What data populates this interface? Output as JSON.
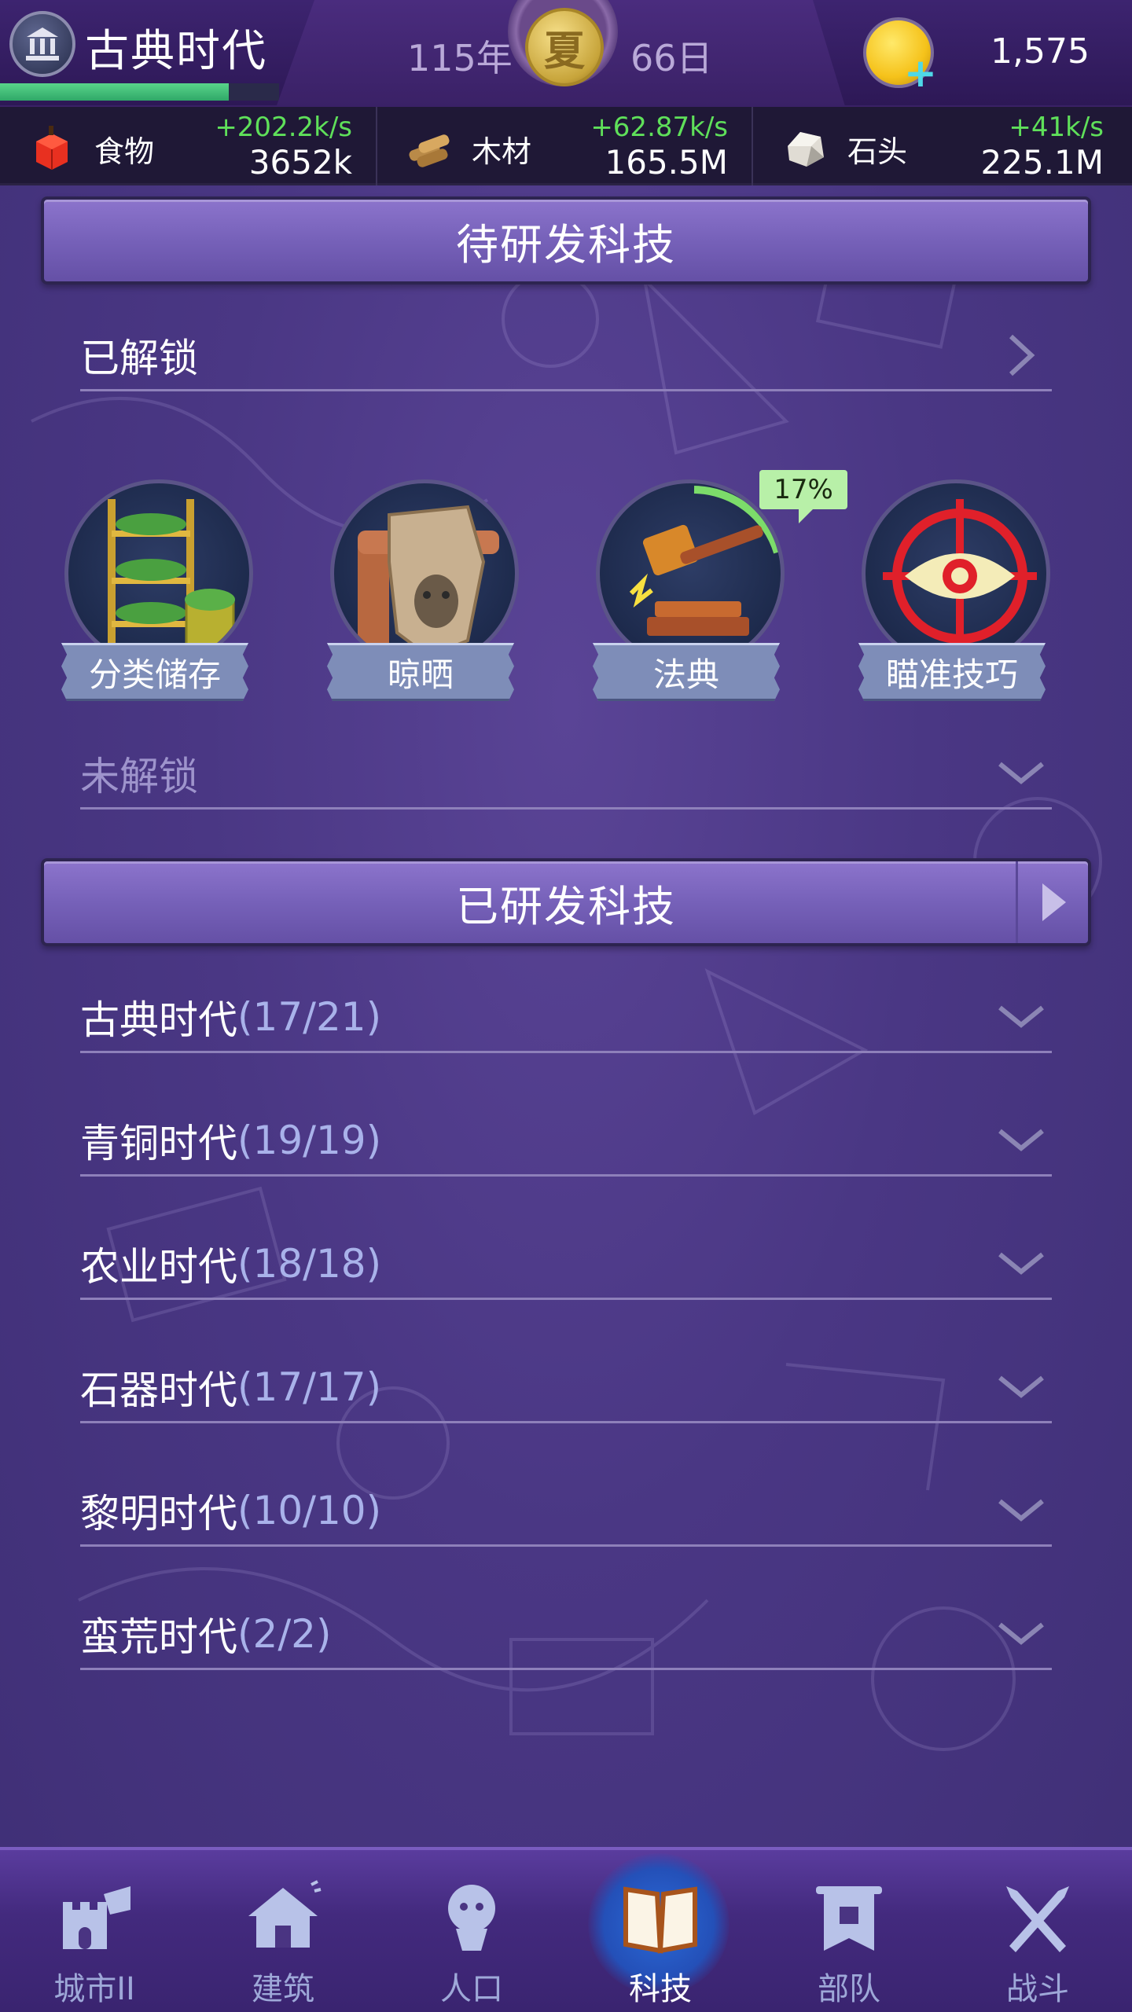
{
  "header": {
    "era_title": "古典时代",
    "era_progress": 0.82,
    "year": "115年",
    "season": "夏",
    "day": "66日",
    "gold": "1,575"
  },
  "resources": [
    {
      "name": "食物",
      "rate": "+202.2k/s",
      "total": "3652k",
      "icon": "food-icon"
    },
    {
      "name": "木材",
      "rate": "+62.87k/s",
      "total": "165.5M",
      "icon": "wood-icon"
    },
    {
      "name": "石头",
      "rate": "+41k/s",
      "total": "225.1M",
      "icon": "stone-icon"
    }
  ],
  "pending": {
    "title": "待研发科技",
    "unlocked_label": "已解锁",
    "locked_label": "未解锁",
    "techs": [
      {
        "name": "分类储存",
        "icon": "shelf-storage-icon"
      },
      {
        "name": "晾晒",
        "icon": "drying-hide-icon"
      },
      {
        "name": "法典",
        "icon": "gavel-icon",
        "progress": "17%"
      },
      {
        "name": "瞄准技巧",
        "icon": "target-eye-icon"
      }
    ]
  },
  "researched": {
    "title": "已研发科技",
    "eras": [
      {
        "name": "古典时代",
        "count": "(17/21)"
      },
      {
        "name": "青铜时代",
        "count": "(19/19)"
      },
      {
        "name": "农业时代",
        "count": "(18/18)"
      },
      {
        "name": "石器时代",
        "count": "(17/17)"
      },
      {
        "name": "黎明时代",
        "count": "(10/10)"
      },
      {
        "name": "蛮荒时代",
        "count": "(2/2)"
      }
    ]
  },
  "nav": [
    {
      "label": "城市II",
      "icon": "castle-icon"
    },
    {
      "label": "建筑",
      "icon": "house-icon"
    },
    {
      "label": "人口",
      "icon": "person-icon"
    },
    {
      "label": "科技",
      "icon": "book-icon",
      "active": true
    },
    {
      "label": "部队",
      "icon": "banner-icon"
    },
    {
      "label": "战斗",
      "icon": "crossed-swords-icon"
    }
  ]
}
